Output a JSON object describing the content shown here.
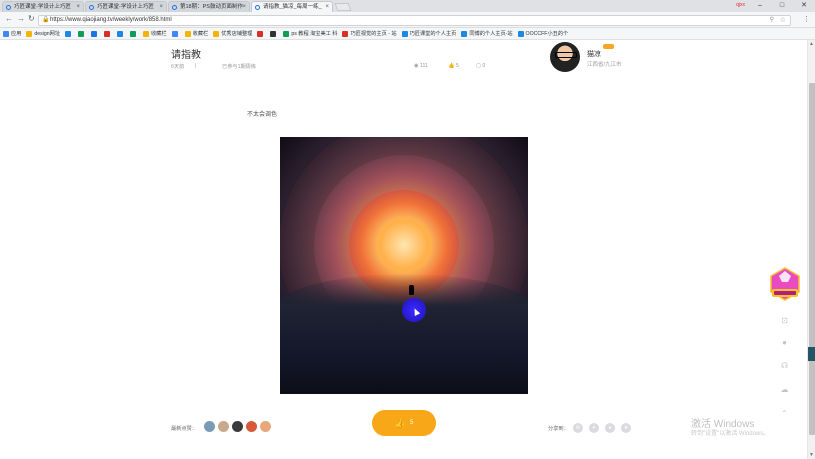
{
  "tabs": [
    {
      "label": "巧匠课堂-学设计上巧匠",
      "active": false
    },
    {
      "label": "巧匠课堂-学设计上巧匠",
      "active": false
    },
    {
      "label": "第18期：PS鼓动页面制作",
      "active": false
    },
    {
      "label": "请指教_猫凉_每周一练_",
      "active": true
    }
  ],
  "browser": {
    "url": "https://www.qiaojiang.tv/weekly/work/858.html",
    "user_chip": "qjxx",
    "window_controls": [
      "–",
      "□",
      "✕"
    ]
  },
  "bookmarks": [
    {
      "label": "应用",
      "color": "#4285f4"
    },
    {
      "label": "design网址",
      "color": "#f4b400"
    },
    {
      "label": "",
      "color": "#1e88e5"
    },
    {
      "label": "",
      "color": "#0f9d58"
    },
    {
      "label": "",
      "color": "#1a73e8"
    },
    {
      "label": "",
      "color": "#d93025"
    },
    {
      "label": "",
      "color": "#1e88e5"
    },
    {
      "label": "",
      "color": "#0f9d58"
    },
    {
      "label": "收藏栏",
      "color": "#f4b400"
    },
    {
      "label": "",
      "color": "#4285f4"
    },
    {
      "label": "收藏栏",
      "color": "#f4b400"
    },
    {
      "label": "优秀店铺整理",
      "color": "#f4b400"
    },
    {
      "label": "",
      "color": "#d93025"
    },
    {
      "label": "",
      "color": "#333333"
    },
    {
      "label": "ps 教程 淘宝美工 科",
      "color": "#0f9d58"
    },
    {
      "label": "巧匠视觉的主页 - 站",
      "color": "#d93025"
    },
    {
      "label": "巧匠课堂的个人主页",
      "color": "#1e88e5"
    },
    {
      "label": "同博的个人主页-站",
      "color": "#1e88e5"
    },
    {
      "label": "OOCCFF小丑的个",
      "color": "#1e88e5"
    }
  ],
  "post": {
    "title": "请指教",
    "date": "6天前",
    "participation": "已参与1期周练",
    "views": "111",
    "likes": "5",
    "comments": "0",
    "description": "不太会调色"
  },
  "author": {
    "name": "猫凉",
    "location": "江西省/九江市",
    "badge_color": "#f5a623"
  },
  "footer": {
    "likers_label": "最新点赞：",
    "like_count": "5",
    "share_label": "分享到：",
    "share_icons": [
      "wechat-icon",
      "weibo-icon",
      "qq-icon",
      "qzone-icon"
    ],
    "liker_colors": [
      "#7a9bb5",
      "#c9a98c",
      "#3a3a3a",
      "#d45a3a",
      "#e8a87c"
    ]
  },
  "watermark": {
    "line1": "激活 Windows",
    "line2": "转到\"设置\"以激活 Windows。"
  },
  "sidebar": {
    "promo_colors": [
      "#e94cc0",
      "#f7c22b"
    ],
    "icons": [
      "cart-icon",
      "chat-icon",
      "headset-icon",
      "cloud-icon",
      "back-to-top-icon"
    ]
  }
}
